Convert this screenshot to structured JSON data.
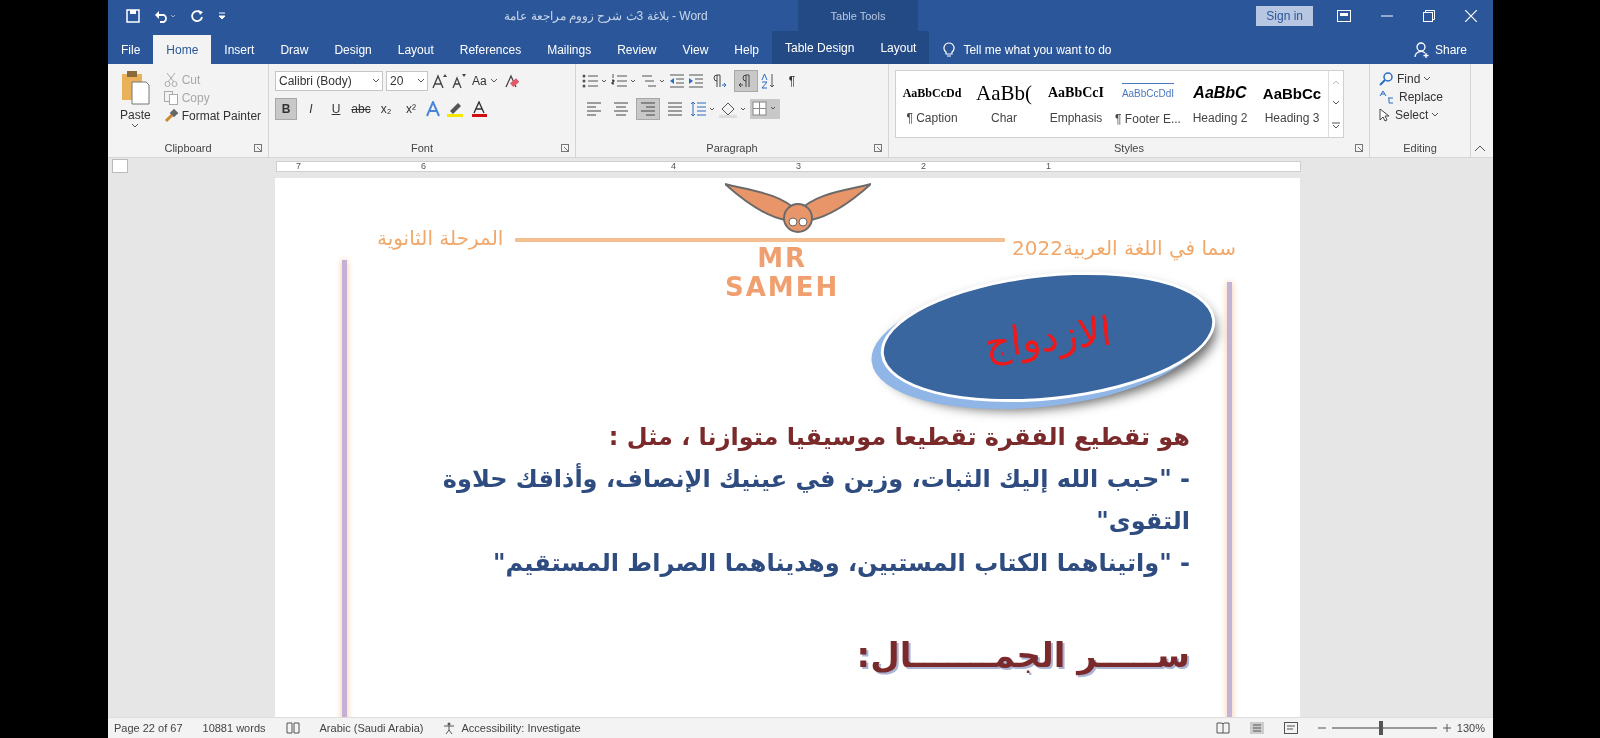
{
  "window": {
    "title": "بلاغة 3ث شرح زووم مراجعة عامة  -  Word",
    "context_group": "Table Tools",
    "sign_in": "Sign in"
  },
  "tabs": [
    {
      "label": "File",
      "selected": false,
      "contextual": false
    },
    {
      "label": "Home",
      "selected": true,
      "contextual": false
    },
    {
      "label": "Insert",
      "selected": false,
      "contextual": false
    },
    {
      "label": "Draw",
      "selected": false,
      "contextual": false
    },
    {
      "label": "Design",
      "selected": false,
      "contextual": false
    },
    {
      "label": "Layout",
      "selected": false,
      "contextual": false
    },
    {
      "label": "References",
      "selected": false,
      "contextual": false
    },
    {
      "label": "Mailings",
      "selected": false,
      "contextual": false
    },
    {
      "label": "Review",
      "selected": false,
      "contextual": false
    },
    {
      "label": "View",
      "selected": false,
      "contextual": false
    },
    {
      "label": "Help",
      "selected": false,
      "contextual": false
    },
    {
      "label": "Table Design",
      "selected": false,
      "contextual": true
    },
    {
      "label": "Layout",
      "selected": false,
      "contextual": true
    }
  ],
  "tell_me": {
    "placeholder": "Tell me what you want to do"
  },
  "share": "Share",
  "clipboard": {
    "label": "Clipboard",
    "paste": "Paste",
    "cut": {
      "label": "Cut",
      "disabled": true
    },
    "copy": {
      "label": "Copy",
      "disabled": true
    },
    "format_painter": {
      "label": "Format Painter",
      "disabled": false
    }
  },
  "font": {
    "label": "Font",
    "font_name": "Calibri (Body)",
    "font_size": "20",
    "case_button": "Aa",
    "buttons": [
      {
        "label": "B",
        "selected": true
      },
      {
        "label": "I",
        "selected": false
      },
      {
        "label": "U",
        "selected": false
      },
      {
        "label": "abc",
        "selected": false
      },
      {
        "label": "x₂",
        "selected": false
      },
      {
        "label": "x²",
        "selected": false
      }
    ]
  },
  "paragraph": {
    "label": "Paragraph",
    "show_marks": "¶",
    "alignment": [
      {
        "kind": "left",
        "selected": false
      },
      {
        "kind": "center",
        "selected": false
      },
      {
        "kind": "right",
        "selected": true
      },
      {
        "kind": "justify",
        "selected": false
      }
    ],
    "direction": [
      {
        "kind": "ltr",
        "selected": false
      },
      {
        "kind": "rtl",
        "selected": true
      }
    ]
  },
  "styles": {
    "label": "Styles",
    "items": [
      {
        "preview": "AaBbCcDd",
        "name": "¶ Caption",
        "kind": "caption"
      },
      {
        "preview": "AaBb(",
        "name": "Char",
        "kind": "serif"
      },
      {
        "preview": "AaBbCcI",
        "name": "Emphasis",
        "kind": "emphasis"
      },
      {
        "preview": "AaBbCcDdI",
        "name": "¶ Footer E...",
        "kind": "footer"
      },
      {
        "preview": "AaBbC",
        "name": "Heading 2",
        "kind": "heading2"
      },
      {
        "preview": "AaBbCc",
        "name": "Heading 3",
        "kind": "heading3"
      }
    ]
  },
  "editing": {
    "label": "Editing",
    "find": "Find",
    "replace": "Replace",
    "select": "Select"
  },
  "ruler": {
    "numbers": [
      "7",
      "6",
      "4",
      "3",
      "2",
      "1"
    ]
  },
  "document": {
    "header_left": "المرحلة الثانوية",
    "header_right": "سما في اللغة العربية2022",
    "logo_lines": [
      "MR",
      "SAMEH"
    ],
    "title": "الازدواج",
    "definition": "هو تقطيع الفقرة تقطيعا موسيقيا متوازنا ، مثل :",
    "examples": [
      "- \"حبب الله إليك الثبات، وزين في عينيك الإنصاف، وأذاقك حلاوة التقوى\"",
      "- \"واتيناهما الكتاب المستبين، وهديناهما الصراط المستقيم\""
    ],
    "heading": "ســـــر الجمـــــــال:"
  },
  "status_bar": {
    "page": "Page 22 of 67",
    "words": "10881 words",
    "language": "Arabic (Saudi Arabia)",
    "accessibility": "Accessibility: Investigate",
    "zoom": "130%",
    "zoom_slider": {
      "level": 0.45
    }
  }
}
